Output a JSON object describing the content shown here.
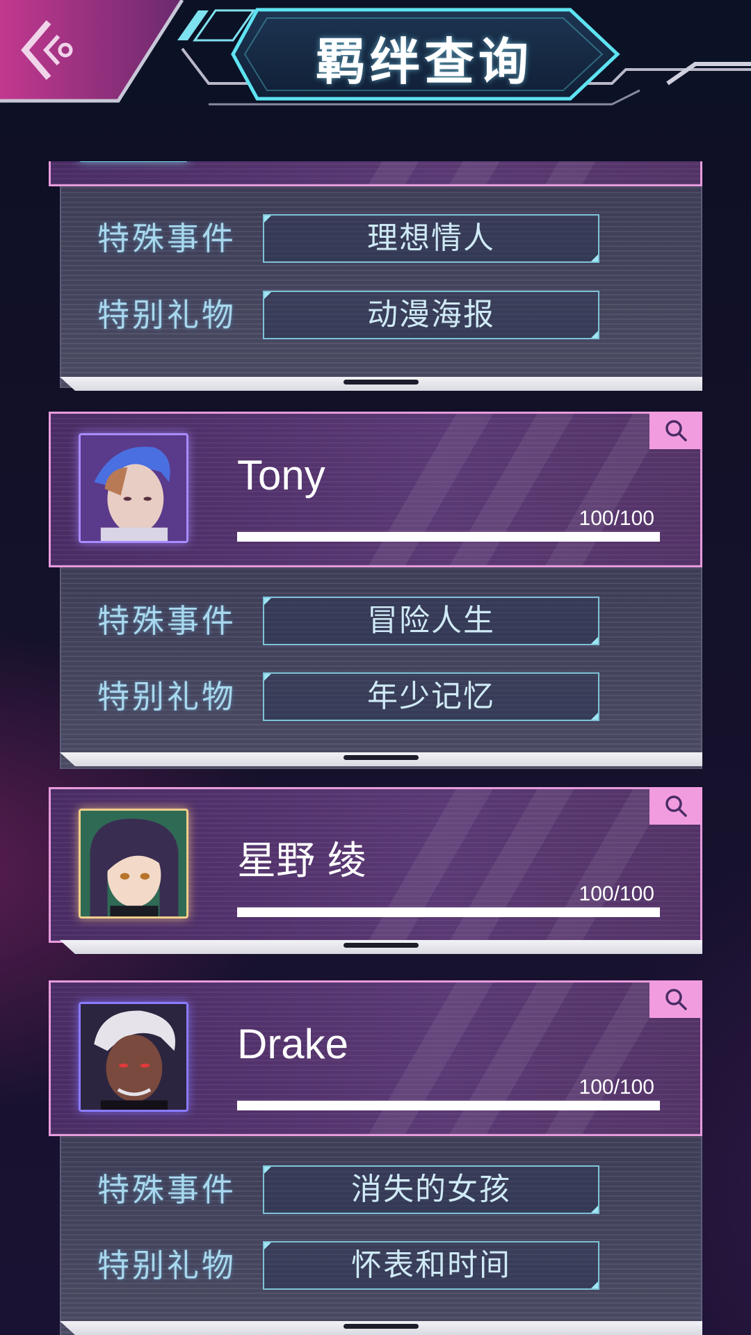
{
  "header": {
    "title": "羁绊查询",
    "back_icon": "back-arrow-icon"
  },
  "labels": {
    "special_event": "特殊事件",
    "special_gift": "特别礼物"
  },
  "partial_entry": {
    "special_event": "理想情人",
    "special_gift": "动漫海报"
  },
  "characters": [
    {
      "name": "Tony",
      "affinity_text": "100/100",
      "affinity": 1.0,
      "special_event": "冒险人生",
      "special_gift": "年少记忆"
    },
    {
      "name": "星野 绫",
      "affinity_text": "100/100",
      "affinity": 1.0
    },
    {
      "name": "Drake",
      "affinity_text": "100/100",
      "affinity": 1.0,
      "special_event": "消失的女孩",
      "special_gift": "怀表和时间"
    }
  ],
  "colors": {
    "card_border": "#e79bdc",
    "search_button": "#f29ce0",
    "label_text": "#a8d8ee",
    "value_border": "#7fc3d8"
  }
}
